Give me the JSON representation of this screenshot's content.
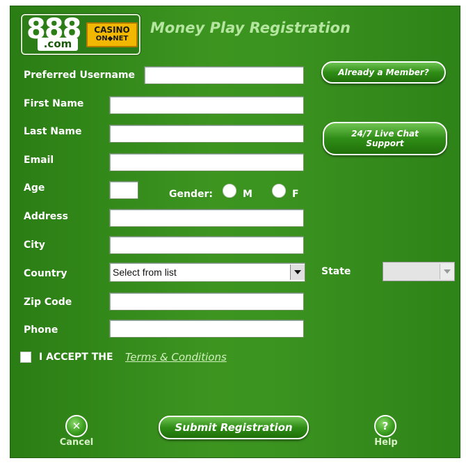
{
  "header": {
    "logo_main": "888",
    "logo_suffix": ".com",
    "logo_casino_line1": "CASINO",
    "logo_casino_line2": "ON◆NET",
    "title": "Money Play Registration"
  },
  "side_buttons": {
    "already_member": "Already a Member?",
    "live_chat_line1": "24/7 Live Chat",
    "live_chat_line2": "Support"
  },
  "form": {
    "username_label": "Preferred Username",
    "first_name_label": "First Name",
    "last_name_label": "Last Name",
    "email_label": "Email",
    "age_label": "Age",
    "gender_label": "Gender:",
    "gender_m": "M",
    "gender_f": "F",
    "address_label": "Address",
    "city_label": "City",
    "country_label": "Country",
    "country_value": "Select from list",
    "state_label": "State",
    "zip_label": "Zip Code",
    "phone_label": "Phone",
    "accept_text": "I ACCEPT THE",
    "terms_link": "Terms & Conditions"
  },
  "footer": {
    "cancel_label": "Cancel",
    "submit_label": "Submit Registration",
    "help_label": "Help",
    "help_glyph": "?",
    "cancel_glyph": "✕"
  },
  "colors": {
    "panel_green": "#3a921f",
    "title_green": "#b5e6a0",
    "logo_gold": "#f2b800"
  }
}
